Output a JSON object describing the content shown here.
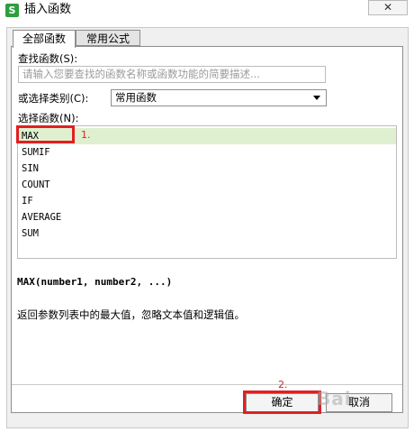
{
  "window": {
    "app_icon": "S",
    "title": "插入函数",
    "close_label": "✕"
  },
  "tabs": [
    {
      "label": "全部函数",
      "active": true
    },
    {
      "label": "常用公式",
      "active": false
    }
  ],
  "search": {
    "label": "查找函数(S):",
    "placeholder": "请输入您要查找的函数名称或函数功能的简要描述..."
  },
  "category": {
    "label": "或选择类别(C):",
    "selected": "常用函数"
  },
  "function_list": {
    "label": "选择函数(N):",
    "items": [
      "MAX",
      "SUMIF",
      "SIN",
      "COUNT",
      "IF",
      "AVERAGE",
      "SUM"
    ],
    "selected_index": 0
  },
  "annotations": {
    "step1": "1.",
    "step2": "2."
  },
  "detail": {
    "signature": "MAX(number1, number2, ...)",
    "description": "返回参数列表中的最大值，忽略文本值和逻辑值。"
  },
  "buttons": {
    "ok": "确定",
    "cancel": "取消"
  },
  "watermark": "Bai",
  "colors": {
    "accent_red": "#e02020",
    "selected_row": "#dff0d0",
    "app_icon_green": "#2e9e3f"
  }
}
